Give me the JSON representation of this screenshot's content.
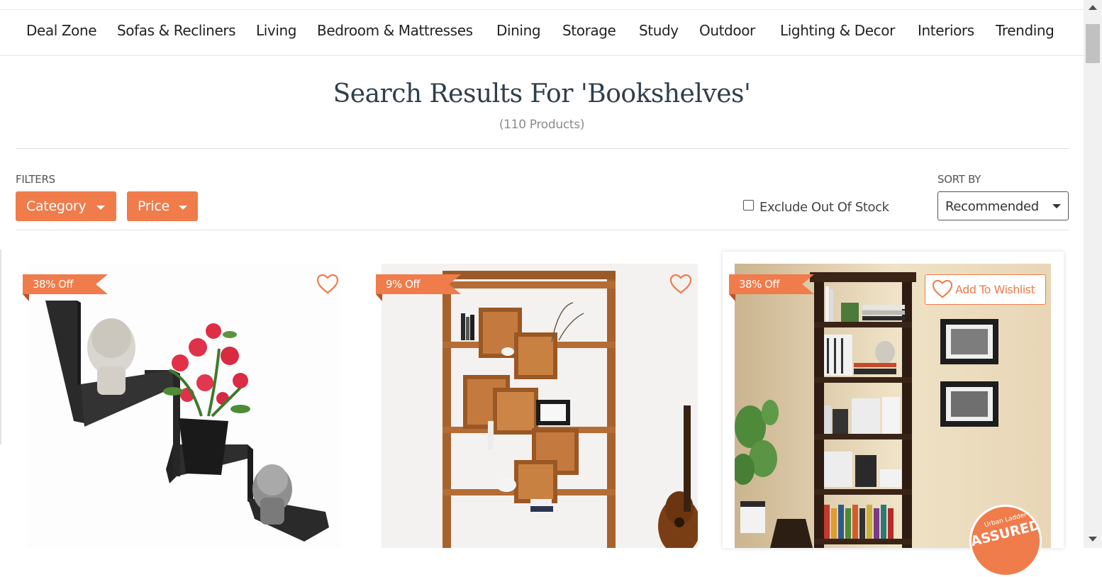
{
  "nav": {
    "items": [
      "Deal Zone",
      "Sofas & Recliners",
      "Living",
      "Bedroom & Mattresses",
      "Dining",
      "Storage",
      "Study",
      "Outdoor",
      "Lighting & Decor",
      "Interiors",
      "Trending"
    ]
  },
  "search": {
    "title": "Search Results For 'Bookshelves'",
    "count": "(110 Products)"
  },
  "filters": {
    "label": "FILTERS",
    "category_label": "Category",
    "price_label": "Price",
    "exclude_out_of_stock_label": "Exclude Out Of Stock",
    "exclude_out_of_stock_checked": false
  },
  "sort": {
    "label": "SORT BY",
    "selected": "Recommended"
  },
  "products": [
    {
      "discount": "38% Off",
      "wishlisted": false
    },
    {
      "discount": "9% Off",
      "wishlisted": false
    },
    {
      "discount": "38% Off",
      "wishlisted": false,
      "wishlist_label": "Add To Wishlist",
      "assured_top": "Urban Ladder",
      "assured_main": "ASSURED"
    }
  ],
  "colors": {
    "accent": "#f07b4b",
    "title": "#2f3f4c"
  }
}
